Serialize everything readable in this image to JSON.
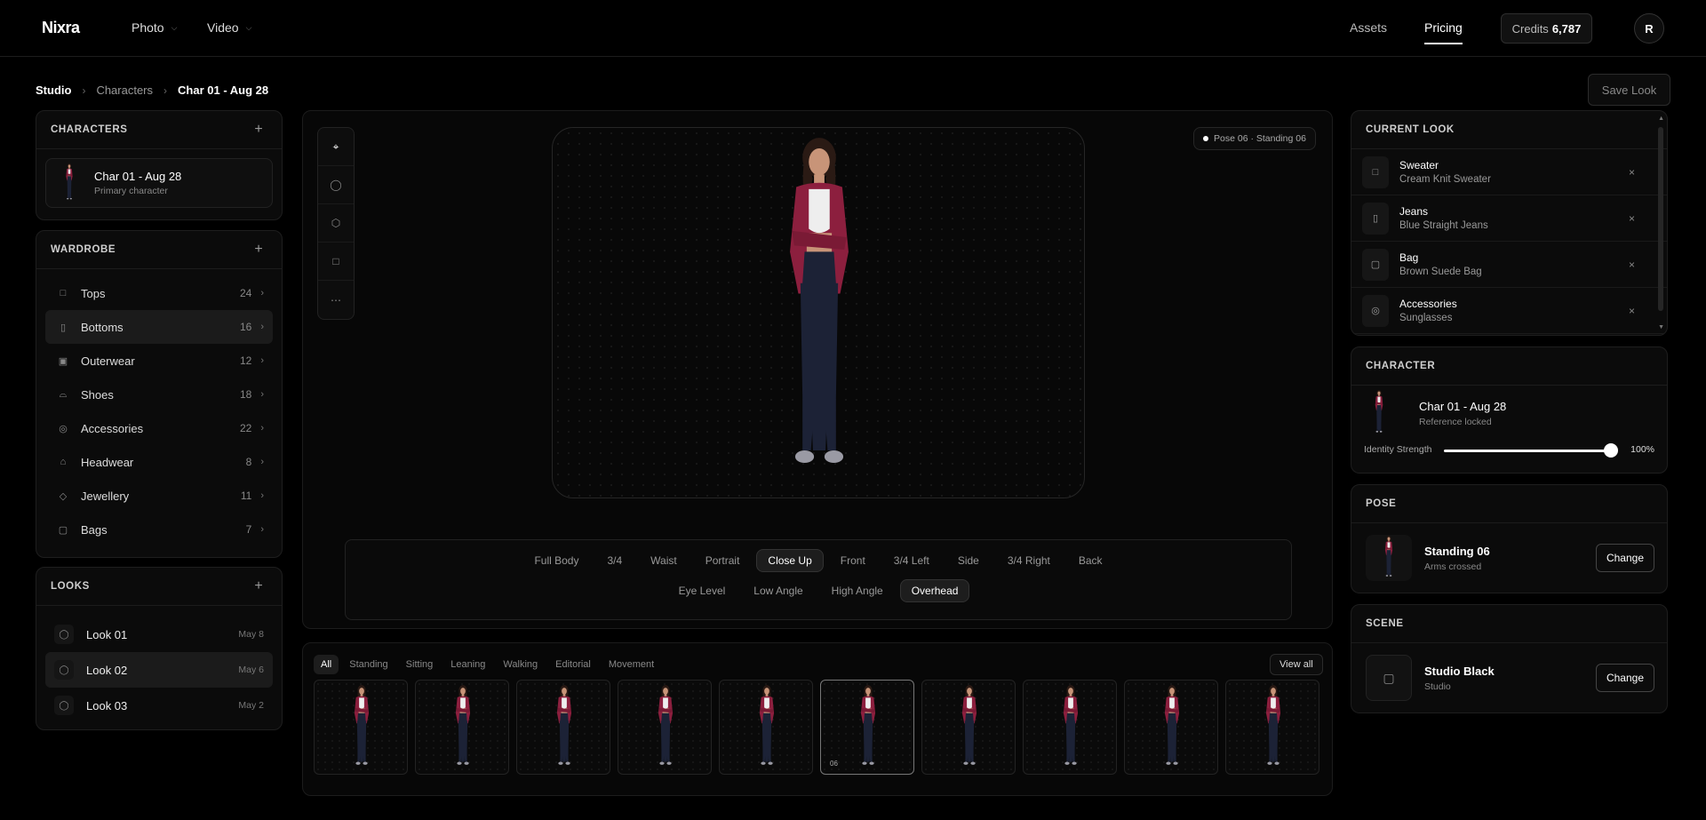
{
  "app": {
    "name": "Nixra"
  },
  "topnav": {
    "photo": "Photo",
    "video": "Video",
    "assets": "Assets",
    "pricing": "Pricing",
    "credits_label": "Credits",
    "credits_value": "6,787",
    "avatar_initial": "R"
  },
  "breadcrumb": {
    "studio": "Studio",
    "characters": "Characters",
    "current": "Char 01 - Aug 28"
  },
  "save_look": "Save Look",
  "characters": {
    "title": "CHARACTERS",
    "item": {
      "name": "Char 01 - Aug 28",
      "sub": "Primary character"
    }
  },
  "wardrobe": {
    "title": "WARDROBE",
    "items": [
      {
        "label": "Tops",
        "count": "24",
        "icon": "shirt-icon"
      },
      {
        "label": "Bottoms",
        "count": "16",
        "icon": "pants-icon"
      },
      {
        "label": "Outerwear",
        "count": "12",
        "icon": "jacket-icon"
      },
      {
        "label": "Shoes",
        "count": "18",
        "icon": "shoe-icon"
      },
      {
        "label": "Accessories",
        "count": "22",
        "icon": "accessory-icon"
      },
      {
        "label": "Headwear",
        "count": "8",
        "icon": "hat-icon"
      },
      {
        "label": "Jewellery",
        "count": "11",
        "icon": "gem-icon"
      },
      {
        "label": "Bags",
        "count": "7",
        "icon": "bag-icon"
      }
    ],
    "active_index": 1
  },
  "looks": {
    "title": "LOOKS",
    "items": [
      {
        "label": "Look 01",
        "date": "May 8"
      },
      {
        "label": "Look 02",
        "date": "May 6"
      },
      {
        "label": "Look 03",
        "date": "May 2"
      }
    ],
    "active_index": 1
  },
  "stage": {
    "pose_pill": "Pose 06 · Standing 06",
    "framing": [
      "Full Body",
      "3/4",
      "Waist",
      "Portrait",
      "Close Up",
      "Front",
      "3/4 Left",
      "Side",
      "3/4 Right",
      "Back"
    ],
    "framing_active": "Close Up",
    "angles": [
      "Eye Level",
      "Low Angle",
      "High Angle",
      "Overhead"
    ],
    "angles_active": "Overhead"
  },
  "pose_strip": {
    "filters": [
      "All",
      "Standing",
      "Sitting",
      "Leaning",
      "Walking",
      "Editorial",
      "Movement"
    ],
    "filter_active": "All",
    "view_all": "View all",
    "thumb_count": 10,
    "active_index": 5,
    "active_label": "06"
  },
  "current_look": {
    "title": "CURRENT LOOK",
    "items": [
      {
        "name": "Sweater",
        "sub": "Cream Knit Sweater"
      },
      {
        "name": "Jeans",
        "sub": "Blue Straight Jeans"
      },
      {
        "name": "Bag",
        "sub": "Brown Suede Bag"
      },
      {
        "name": "Accessories",
        "sub": "Sunglasses"
      }
    ]
  },
  "character_panel": {
    "title": "CHARACTER",
    "name": "Char 01 - Aug 28",
    "sub": "Reference locked",
    "identity_label": "Identity Strength",
    "identity_value": "100%",
    "identity_fraction": 1.0
  },
  "pose_panel": {
    "title": "POSE",
    "name": "Standing 06",
    "sub": "Arms crossed",
    "button": "Change"
  },
  "scene_panel": {
    "title": "SCENE",
    "name": "Studio Black",
    "sub": "Studio",
    "button": "Change"
  },
  "colors": {
    "background": "#000000",
    "jacket": "#8c1f3e",
    "leggings": "#1c2236",
    "accent": "#ffffff"
  }
}
